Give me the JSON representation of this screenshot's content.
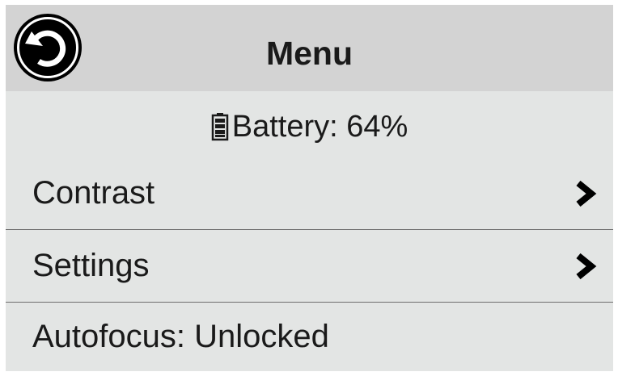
{
  "header": {
    "title": "Menu",
    "back_icon": "back-icon"
  },
  "status": {
    "battery_icon": "battery-icon",
    "battery_text": "Battery: 64%",
    "battery_level": 0.64
  },
  "menu": {
    "items": [
      {
        "label": "Contrast",
        "icon": "chevron-right-icon"
      },
      {
        "label": "Settings",
        "icon": "chevron-right-icon"
      },
      {
        "label": "Autofocus: Unlocked"
      }
    ]
  },
  "colors": {
    "header_bg": "#d3d3d3",
    "screen_bg": "#e3e5e4",
    "text": "#1a1a1a",
    "divider": "#6e6e6e",
    "icon": "#000000"
  }
}
